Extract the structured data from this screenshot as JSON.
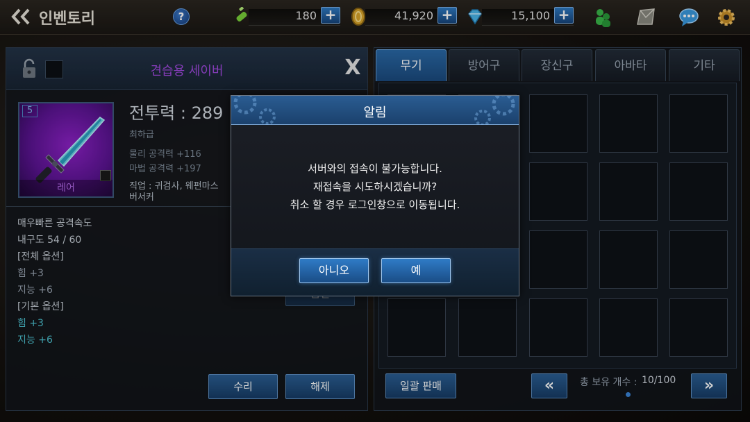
{
  "header": {
    "title": "인벤토리",
    "help_label": "?",
    "currencies": [
      {
        "name": "stamina",
        "icon": "syringe-icon",
        "value": "180",
        "plus": "+"
      },
      {
        "name": "gold",
        "icon": "gold-coin-icon",
        "value": "41,920",
        "plus": "+"
      },
      {
        "name": "gem",
        "icon": "diamond-icon",
        "value": "15,100",
        "plus": "+"
      }
    ],
    "right_icons": [
      "friends-icon",
      "mail-icon",
      "chat-icon",
      "settings-gear-icon"
    ]
  },
  "item_panel": {
    "item_name": "견습용 세이버",
    "close_label": "X",
    "level": "5",
    "grade": "레어",
    "combat_power": "전투력 : 289",
    "tier": "최하급",
    "physical_attack": "물리 공격력 +116",
    "magic_attack": "마법 공격력 +197",
    "job_line1": "직업 : 귀검사, 웨펀마스",
    "job_line2": "버서커",
    "desc": {
      "attack_speed": "매우빠른 공격속도",
      "durability": "내구도 54 / 60",
      "all_options_header": "[전체 옵션]",
      "all_str": "힘 +3",
      "all_int": "지능 +6",
      "base_options_header": "[기본 옵션]",
      "base_str": "힘 +3",
      "base_int": "지능 +6"
    },
    "hidden_btn": "품질",
    "repair_label": "수리",
    "dismantle_label": "해제"
  },
  "inventory": {
    "tabs": [
      "무기",
      "방어구",
      "장신구",
      "아바타",
      "기타"
    ],
    "active_tab": 0,
    "bulk_sell_label": "일괄 판매",
    "prev_label": "«",
    "next_label": "»",
    "count_label": "총 보유 개수 :",
    "count_value": "10/100"
  },
  "dialog": {
    "title": "알림",
    "line1": "서버와의 접속이 불가능합니다.",
    "line2": "재접속을 시도하시겠습니까?",
    "line3": "취소 할 경우 로그인창으로 이동됩니다.",
    "no_label": "아니오",
    "yes_label": "예"
  },
  "colors": {
    "accent_blue": "#2a6aa8",
    "item_name_purple": "#a14ae0",
    "option_cyan": "#4ec4d2"
  }
}
